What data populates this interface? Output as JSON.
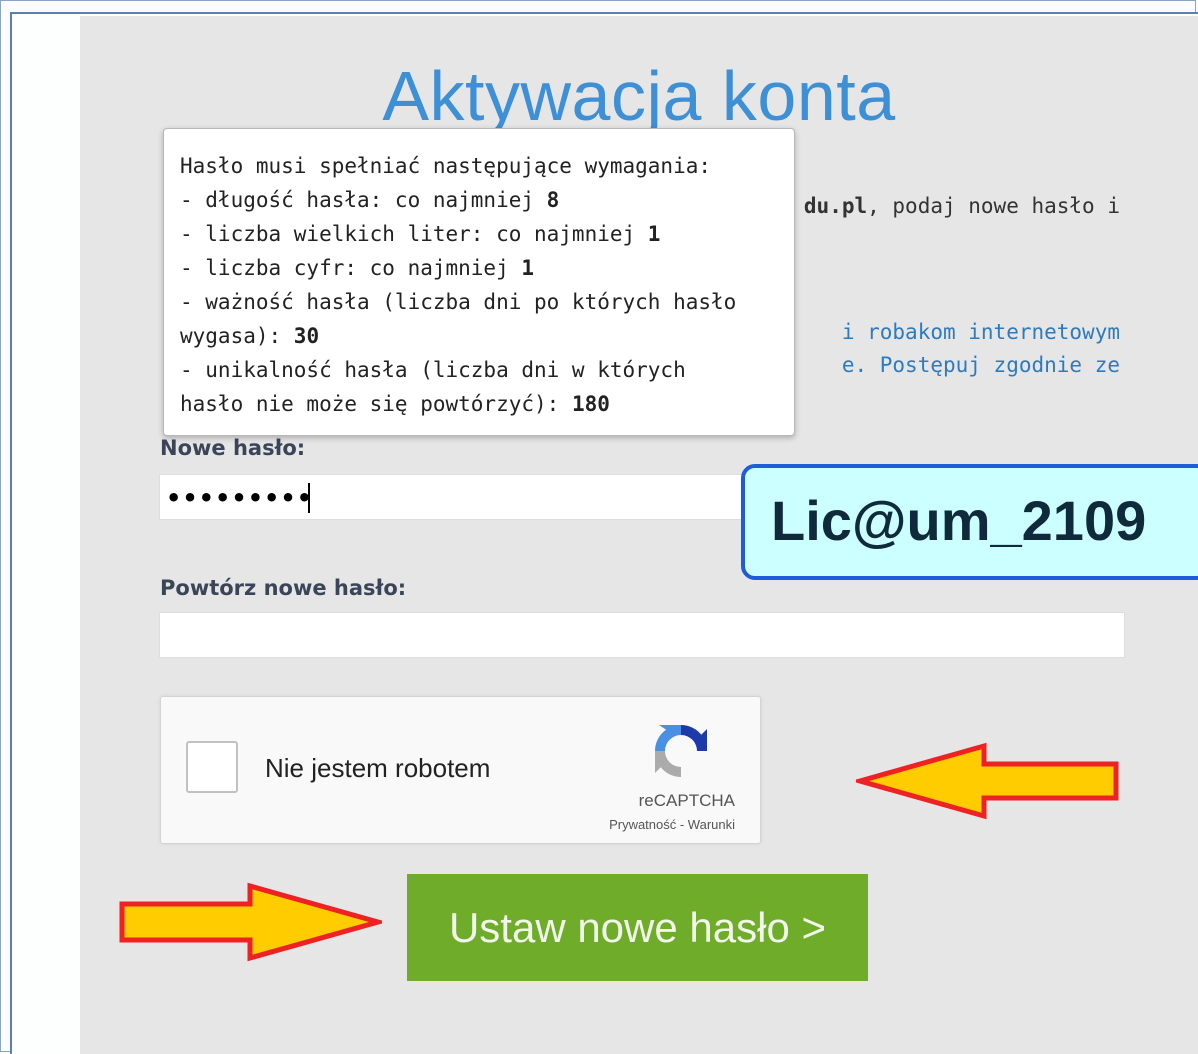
{
  "page": {
    "title": "Aktywacja konta",
    "intro_visible_bold": "du.pl",
    "intro_visible_rest": ", podaj nowe hasło i",
    "warning_line1": "i robakom internetowym",
    "warning_line2": "e. Postępuj zgodnie ze"
  },
  "tooltip": {
    "heading": "Hasło musi spełniać następujące wymagania:",
    "length_label": "- długość hasła: co najmniej ",
    "length_value": "8",
    "uppercase_label": "- liczba wielkich liter: co najmniej ",
    "uppercase_value": "1",
    "digits_label": "- liczba cyfr: co najmniej ",
    "digits_value": "1",
    "validity_line1": "- ważność hasła (liczba dni po których hasło",
    "validity_line2_label": "wygasa): ",
    "validity_value": "30",
    "uniqueness_line1": "- unikalność hasła (liczba dni w których",
    "uniqueness_line2_label": "hasło nie może się powtórzyć): ",
    "uniqueness_value": "180"
  },
  "form": {
    "new_password_label": "Nowe hasło:",
    "new_password_value": "•••••••••",
    "repeat_password_label": "Powtórz nowe hasło:",
    "repeat_password_value": "",
    "submit_label": "Ustaw nowe hasło >"
  },
  "recaptcha": {
    "label": "Nie jestem robotem",
    "brand": "reCAPTCHA",
    "links": "Prywatność - Warunki",
    "checked": false
  },
  "annotation": {
    "example_password": "Lic@um_2109",
    "arrow_color": "#ffcc00",
    "arrow_outline": "#ee2222"
  }
}
